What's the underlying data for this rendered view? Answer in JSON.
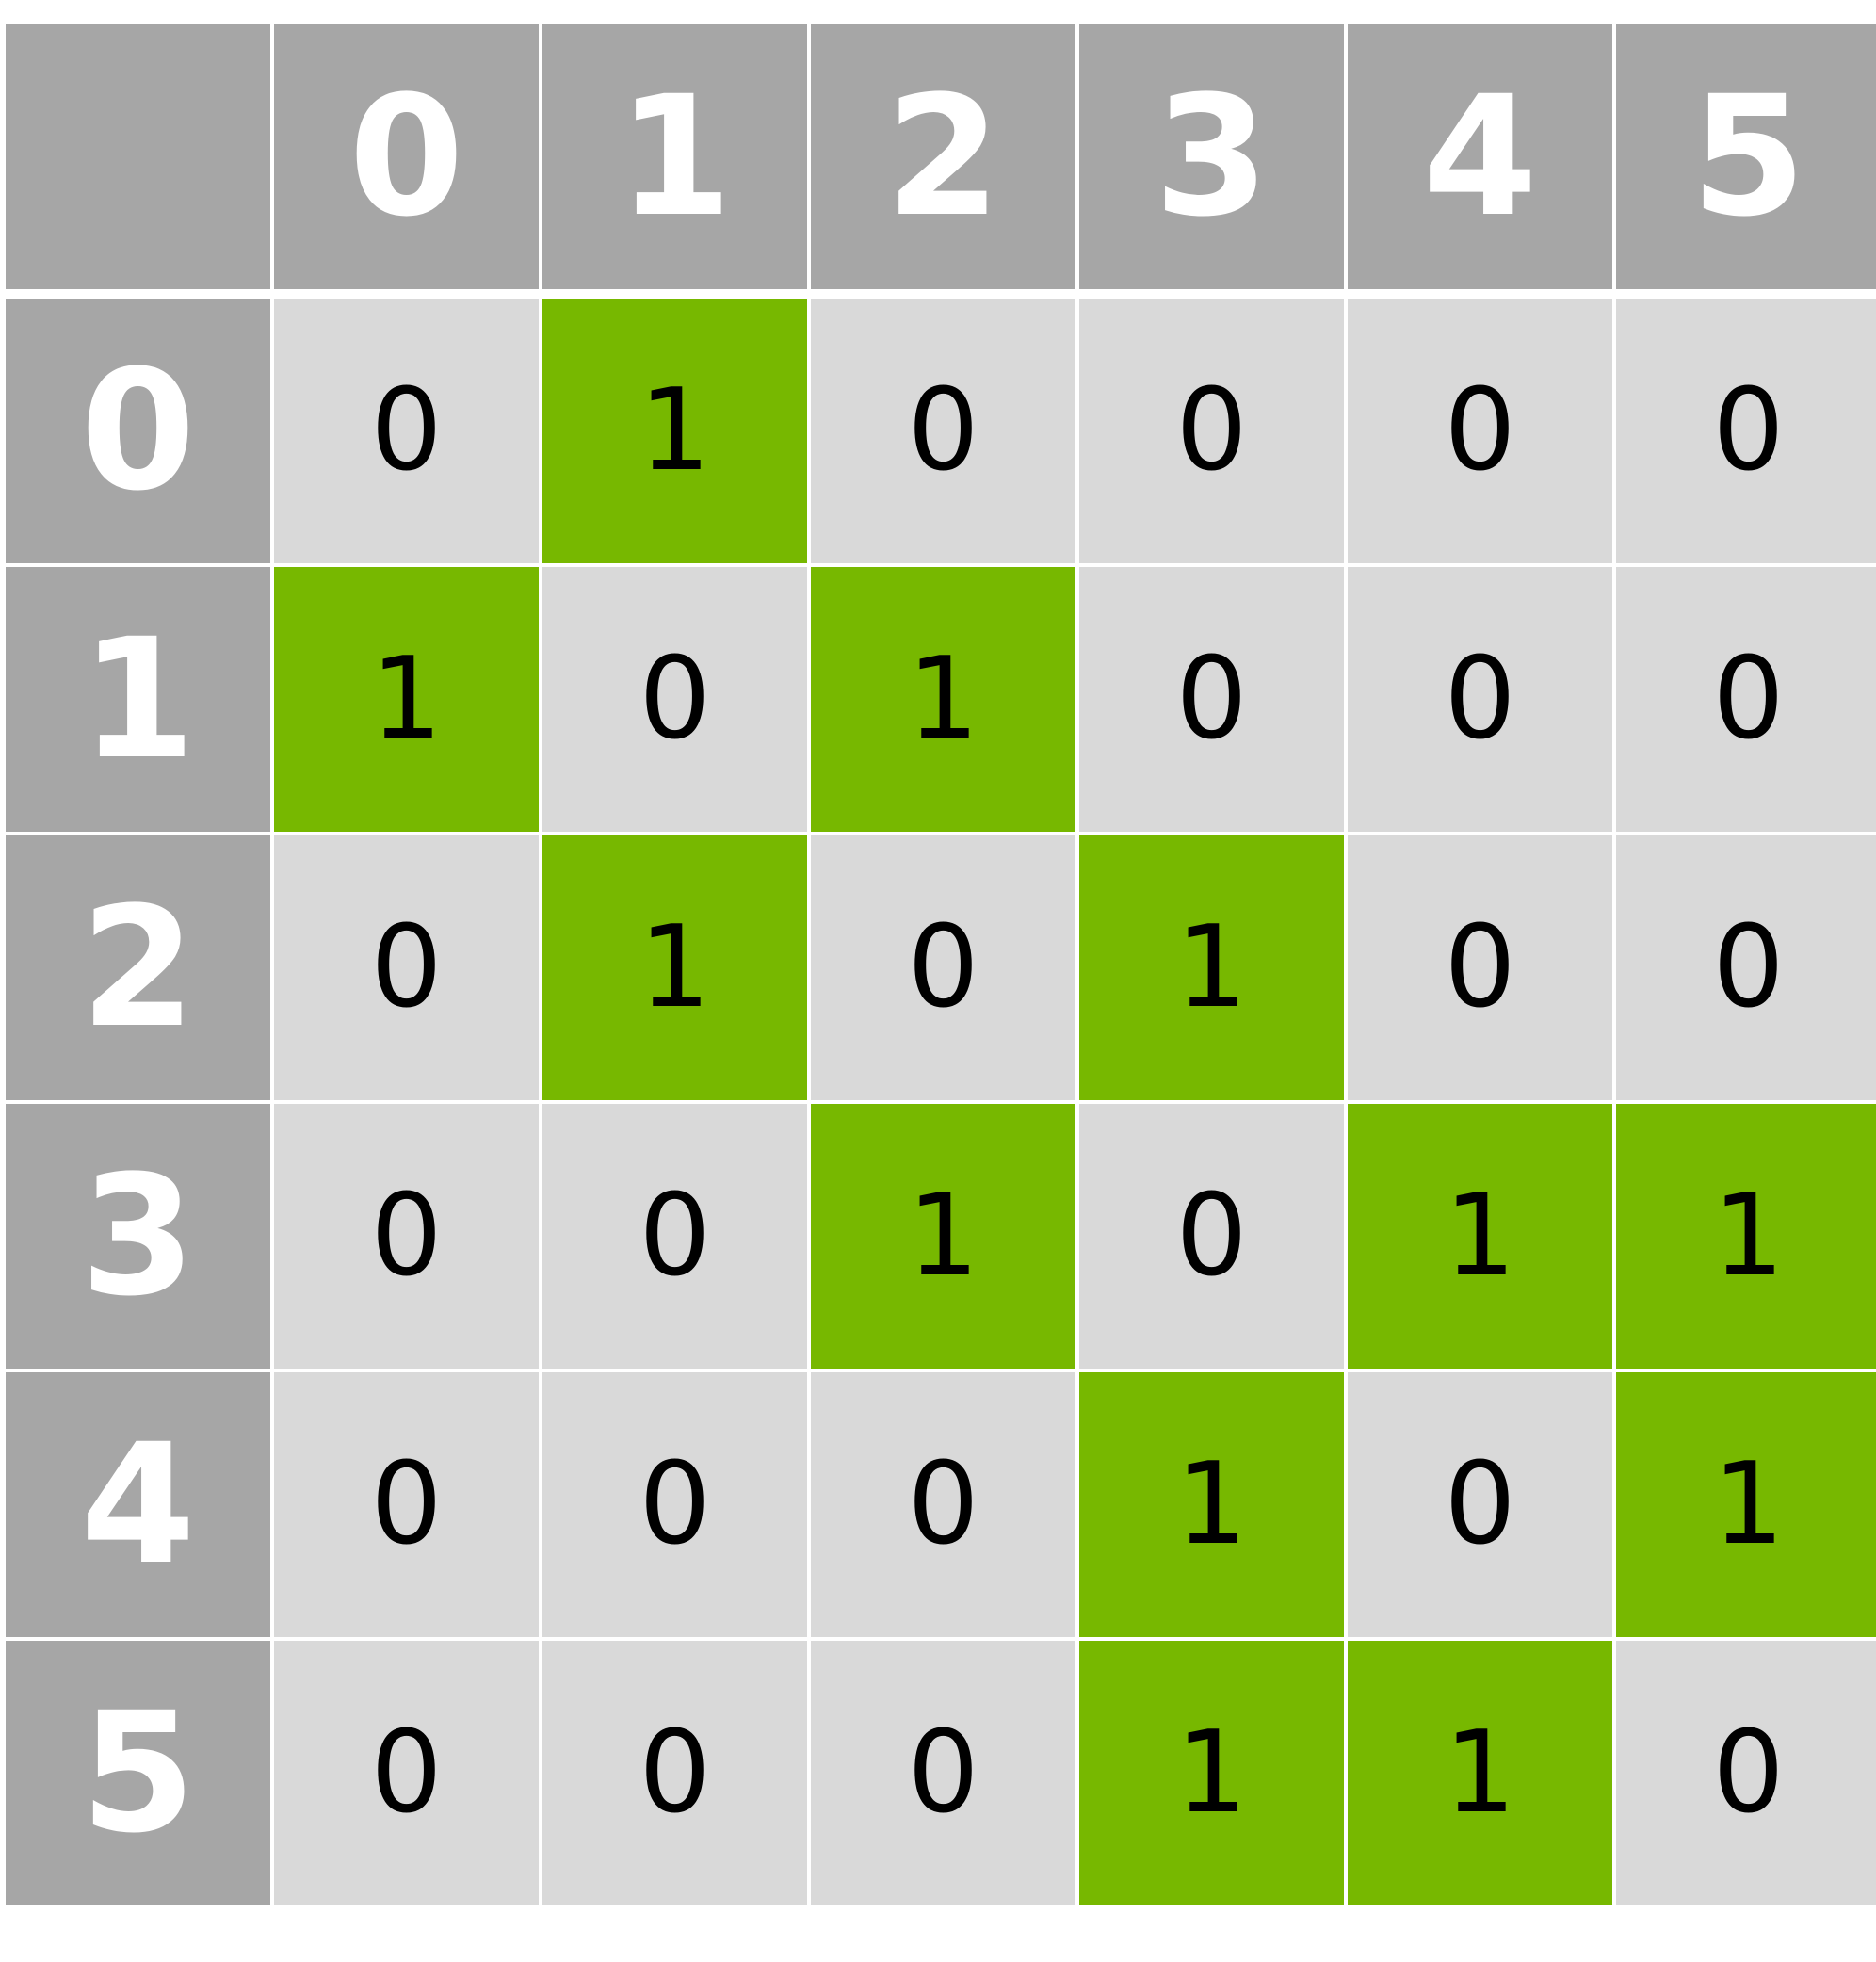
{
  "matrix": {
    "col_headers": [
      "0",
      "1",
      "2",
      "3",
      "4",
      "5"
    ],
    "row_headers": [
      "0",
      "1",
      "2",
      "3",
      "4",
      "5"
    ],
    "rows": [
      [
        "0",
        "1",
        "0",
        "0",
        "0",
        "0"
      ],
      [
        "1",
        "0",
        "1",
        "0",
        "0",
        "0"
      ],
      [
        "0",
        "1",
        "0",
        "1",
        "0",
        "0"
      ],
      [
        "0",
        "0",
        "1",
        "0",
        "1",
        "1"
      ],
      [
        "0",
        "0",
        "0",
        "1",
        "0",
        "1"
      ],
      [
        "0",
        "0",
        "0",
        "1",
        "1",
        "0"
      ]
    ]
  },
  "colors": {
    "header_bg": "#a6a6a6",
    "header_text": "#ffffff",
    "cell_off": "#d9d9d9",
    "cell_on": "#77b800",
    "cell_text": "#000000"
  }
}
